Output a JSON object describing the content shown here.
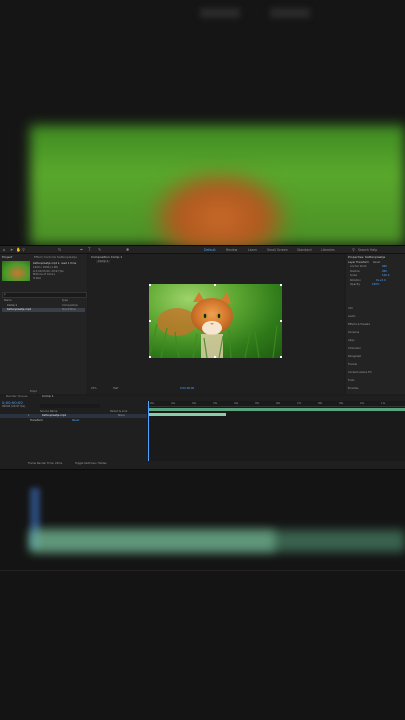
{
  "window": {
    "title": "Adobe After Effects"
  },
  "toolbar": {
    "workspaces": [
      "Default",
      "Review",
      "Learn",
      "Small Screen",
      "Standard",
      "Libraries"
    ],
    "active_workspace": "Default",
    "search_placeholder": "Search Help"
  },
  "project_panel": {
    "tab_label": "Project",
    "effects_tab": "Effect Controls Kattenplaatje",
    "preview": {
      "name": "Kattenplaatje.mp4 ▾, used 1 time",
      "size": "1920 x 1080 (1.00)",
      "duration": "Δ 0;00;05;00, 29.97 fps",
      "colors": "Millions of Colors",
      "codec": "H.264"
    },
    "search_placeholder": "ρ",
    "columns": {
      "name": "Name",
      "type": "Type"
    },
    "items": [
      {
        "name": "Comp 1",
        "type": "Composition"
      },
      {
        "name": "Kattenplaatje.mp4",
        "type": "QuickTime"
      }
    ],
    "bpc": "8 bpc"
  },
  "composition_panel": {
    "tab_label": "Composition Comp 1",
    "subtab": "Comp 1",
    "zoom": "25%",
    "resolution": "Half",
    "timecode": "0;00;00;00"
  },
  "properties_panel": {
    "title": "Properties: Kattenplaatje",
    "section": "Layer Transform",
    "reset": "Reset",
    "rows": [
      {
        "label": "Anchor Point",
        "value": "960"
      },
      {
        "label": "Position",
        "value": "960"
      },
      {
        "label": "Scale",
        "value": "100.0"
      },
      {
        "label": "Rotation",
        "value": "0x+0.0"
      },
      {
        "label": "Opacity",
        "value": "100%"
      }
    ],
    "panels": [
      "Info",
      "Audio",
      "Effects & Presets",
      "Libraries",
      "Align",
      "Character",
      "Paragraph",
      "Tracker",
      "Content-Aware Fill",
      "Tools",
      "Brushes"
    ]
  },
  "timeline": {
    "render_queue_tab": "Render Queue",
    "comp_tab": "Comp 1",
    "timecode": "0;00;00;00",
    "fps": "00000 (29.97 fps)",
    "columns": {
      "source": "Source Name",
      "parent": "Parent & Link"
    },
    "layer": {
      "index": "1",
      "name": "Kattenplaatje.mp4",
      "parent": "None"
    },
    "property": {
      "label": "Transform",
      "reset": "Reset"
    },
    "ruler": [
      "00s",
      "01s",
      "02s",
      "03s",
      "04s",
      "05s",
      "06s",
      "07s",
      "08s",
      "09s",
      "10s",
      "11s"
    ],
    "footer": {
      "render_time": "Frame Render Time: 24ms",
      "toggle": "Toggle Switches / Modes"
    }
  },
  "colors": {
    "accent": "#4da3ff",
    "track": "#5aa37f",
    "track_light": "#86cfa8"
  },
  "icons": [
    "home-icon",
    "selection-tool-icon",
    "hand-tool-icon",
    "zoom-tool-icon",
    "rotate-tool-icon",
    "pen-tool-icon",
    "type-tool-icon",
    "brush-tool-icon",
    "puppet-tool-icon",
    "search-icon"
  ]
}
